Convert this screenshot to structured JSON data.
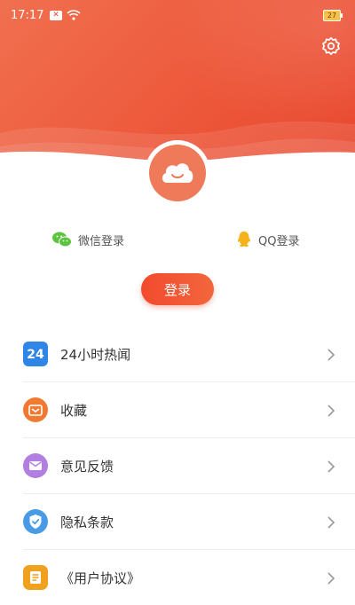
{
  "status_bar": {
    "time": "17:17",
    "battery": "27"
  },
  "header": {
    "settings_icon": "gear-icon",
    "avatar_icon": "cloud-smile-icon"
  },
  "login_options": {
    "wechat_label": "微信登录",
    "qq_label": "QQ登录"
  },
  "login_button": "登录",
  "menu": [
    {
      "label": "24小时热闻",
      "icon": "hot-news-24-icon",
      "color": "#2f86e6"
    },
    {
      "label": "收藏",
      "icon": "favorite-box-icon",
      "color": "#f07a32"
    },
    {
      "label": "意见反馈",
      "icon": "mail-icon",
      "color": "#b27ee0"
    },
    {
      "label": "隐私条款",
      "icon": "shield-check-icon",
      "color": "#4a9be6"
    },
    {
      "label": "《用户协议》",
      "icon": "document-icon",
      "color": "#f0a21e"
    }
  ],
  "colors": {
    "header": "#ee5d3f",
    "accent": "#f24a2e"
  }
}
